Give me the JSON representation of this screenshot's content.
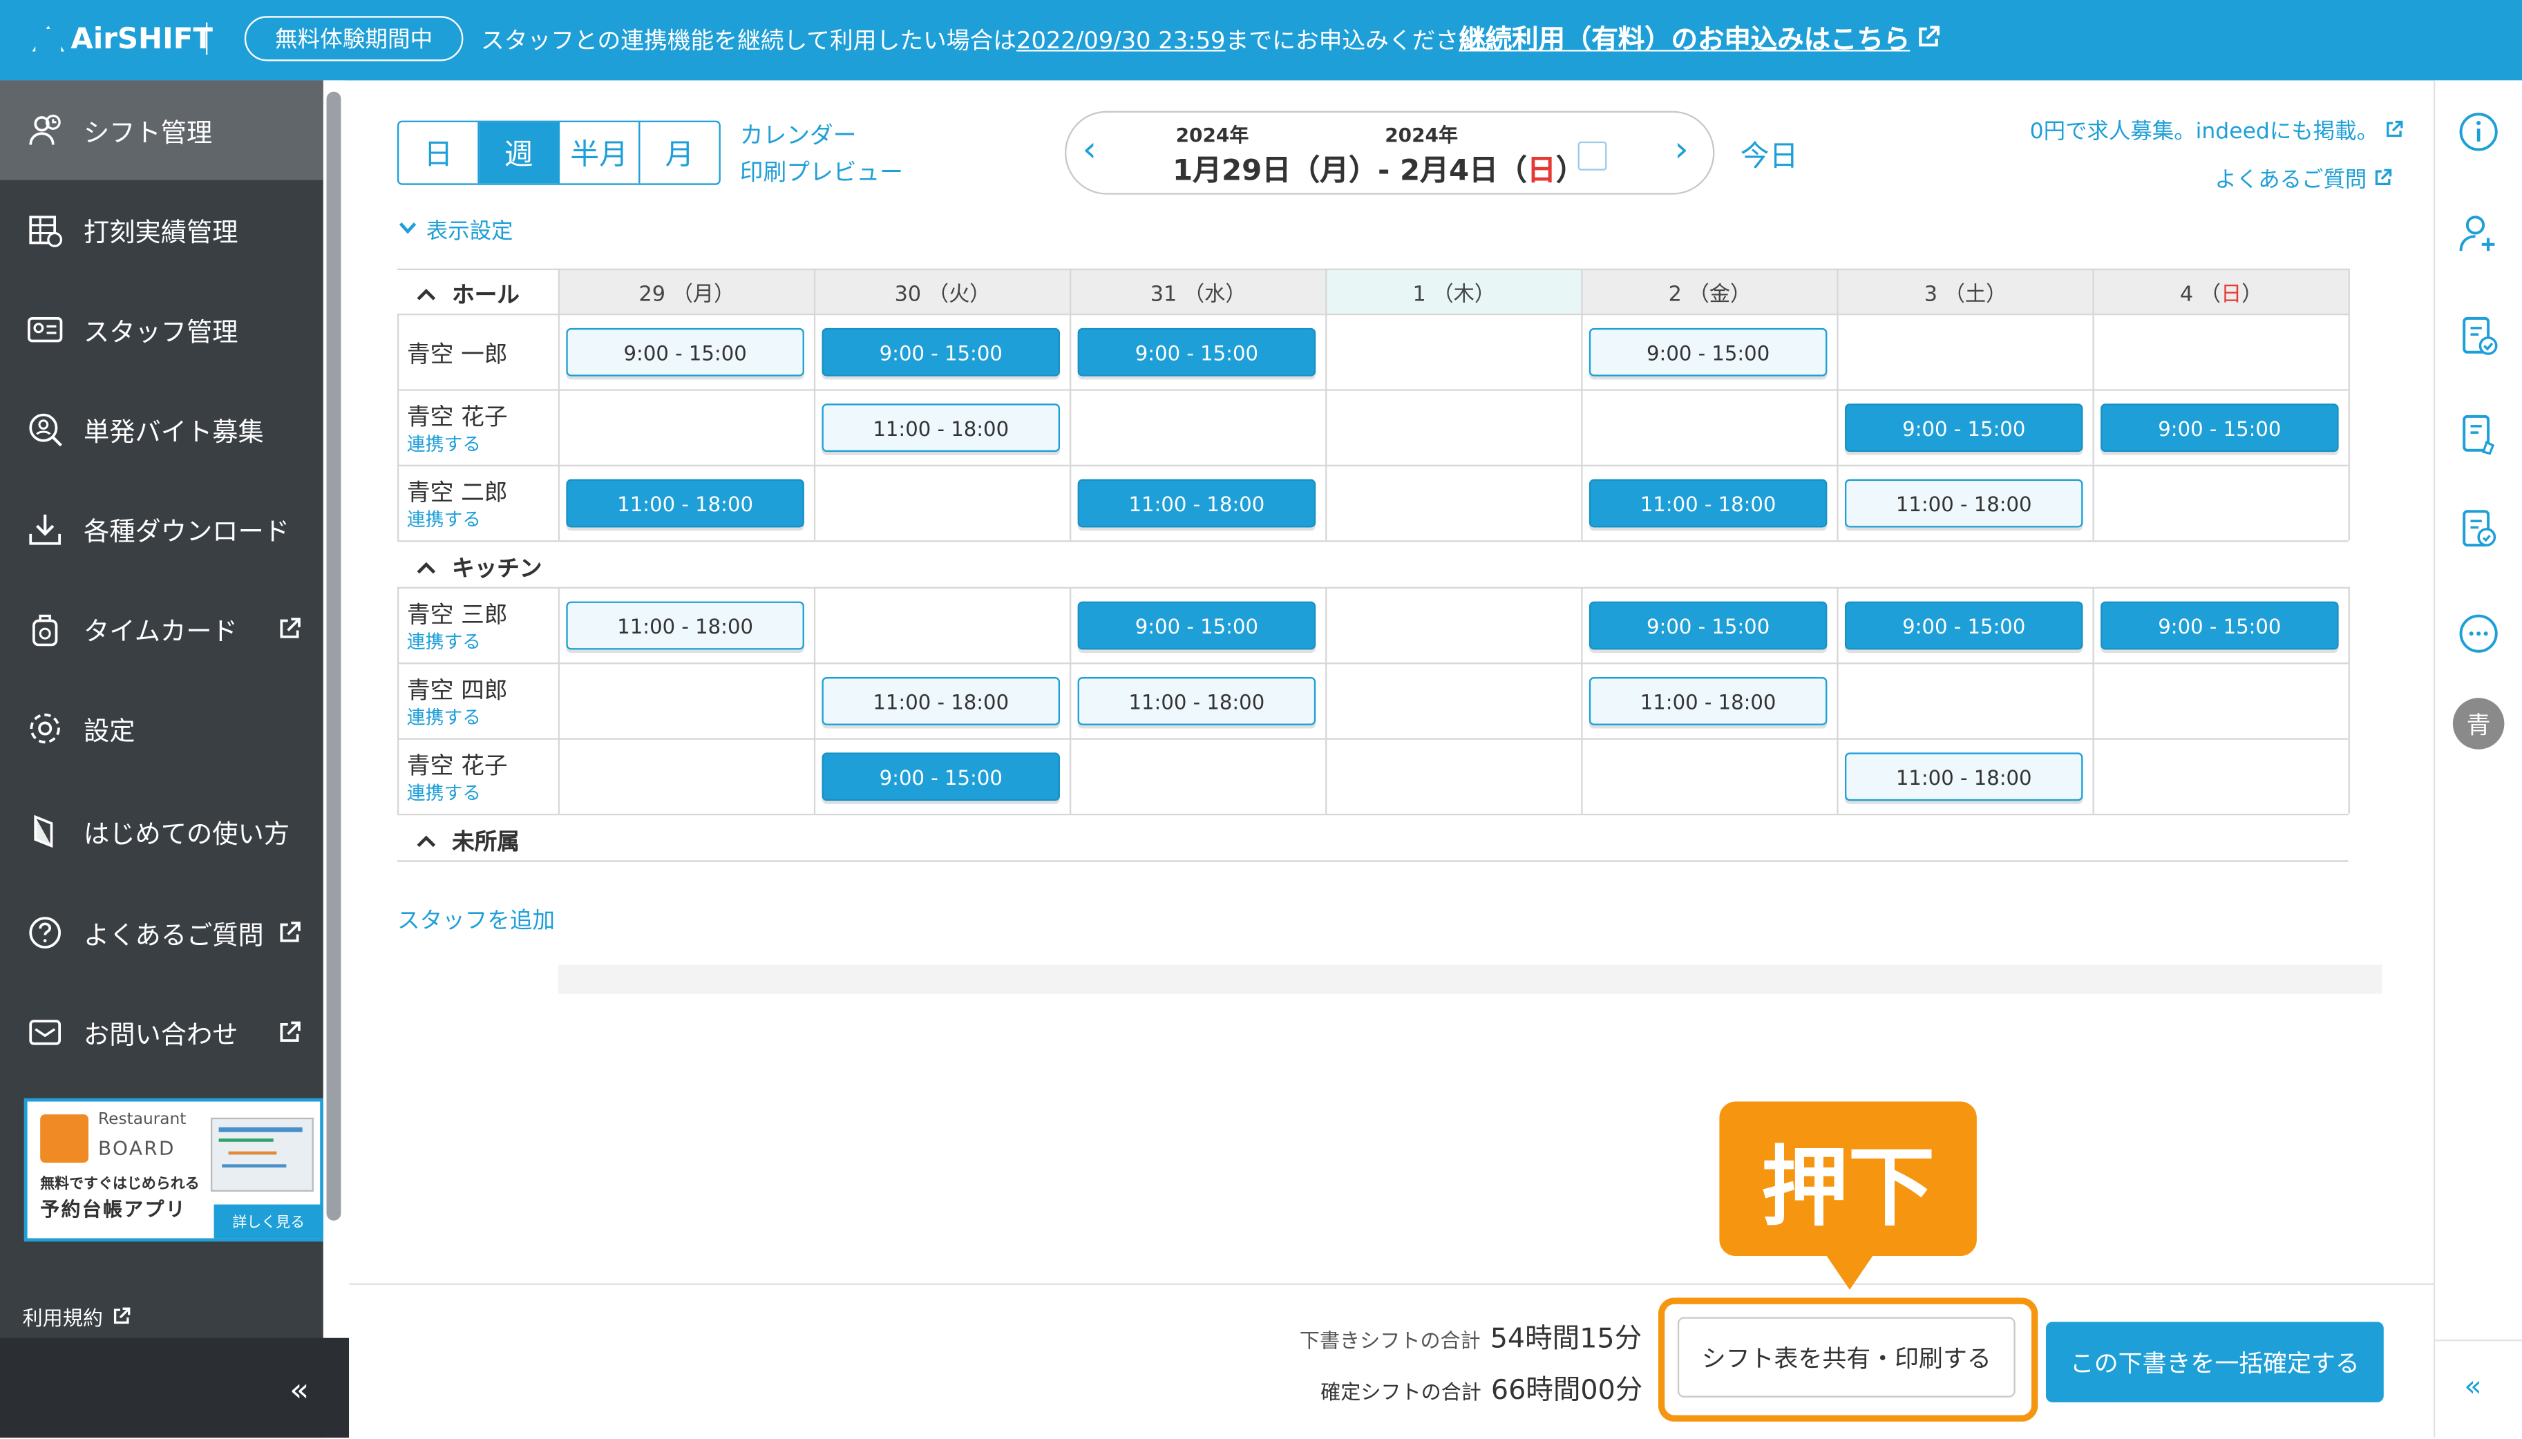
{
  "banner": {
    "logo": "AirSHIFT",
    "trial_badge": "無料体験期間中",
    "message_prefix": "スタッフとの連携機能を継続して利用したい場合は",
    "deadline": "2022/09/30 23:59",
    "message_suffix": "までにお申込みください。",
    "cta_link": "継続利用（有料）のお申込みはこちら"
  },
  "sidebar": {
    "items": [
      {
        "label": "シフト管理",
        "icon": "shift-icon"
      },
      {
        "label": "打刻実績管理",
        "icon": "timesheet-icon"
      },
      {
        "label": "スタッフ管理",
        "icon": "staff-card-icon"
      },
      {
        "label": "単発バイト募集",
        "icon": "person-search-icon"
      },
      {
        "label": "各種ダウンロード",
        "icon": "download-icon"
      },
      {
        "label": "タイムカード",
        "icon": "timecard-icon"
      },
      {
        "label": "設定",
        "icon": "gear-icon"
      },
      {
        "label": "はじめての使い方",
        "icon": "guide-icon"
      },
      {
        "label": "よくあるご質問",
        "icon": "question-icon"
      },
      {
        "label": "お問い合わせ",
        "icon": "mail-icon"
      }
    ],
    "ad": {
      "brand_top": "Restaurant",
      "brand_bottom": "BOARD",
      "line1": "無料ですぐはじめられる",
      "line2": "予約台帳アプリ",
      "more": "詳しく見る"
    },
    "terms": "利用規約",
    "collapse": "«"
  },
  "toolbar": {
    "views": [
      "日",
      "週",
      "半月",
      "月"
    ],
    "selected_view": "週",
    "calendar_link": "カレンダー",
    "print_preview_link": "印刷プレビュー",
    "year_start": "2024年",
    "year_end": "2024年",
    "range_start": "1月29日（月）",
    "range_sep": "- ",
    "range_end_prefix": "2月4日（",
    "range_end_day": "日",
    "range_end_suffix": "）",
    "today": "今日",
    "indeed_link": "0円で求人募集。indeedにも掲載。",
    "faq_link": "よくあるご質問",
    "display_settings": "表示設定"
  },
  "grid": {
    "days": [
      {
        "num": "29",
        "dow": "月"
      },
      {
        "num": "30",
        "dow": "火"
      },
      {
        "num": "31",
        "dow": "水"
      },
      {
        "num": "1",
        "dow": "木"
      },
      {
        "num": "2",
        "dow": "金"
      },
      {
        "num": "3",
        "dow": "土"
      },
      {
        "num": "4",
        "dow": "日"
      }
    ],
    "groups": {
      "hall": "ホール",
      "kitchen": "キッチン",
      "unassigned": "未所属"
    },
    "link_label": "連携する",
    "staff": [
      {
        "name": "青空 一郎",
        "linkable": false,
        "shifts": [
          {
            "day": 0,
            "time": "9:00 - 15:00",
            "style": "light"
          },
          {
            "day": 1,
            "time": "9:00 - 15:00",
            "style": "solid"
          },
          {
            "day": 2,
            "time": "9:00 - 15:00",
            "style": "solid"
          },
          {
            "day": 4,
            "time": "9:00 - 15:00",
            "style": "light"
          }
        ]
      },
      {
        "name": "青空 花子",
        "linkable": true,
        "shifts": [
          {
            "day": 1,
            "time": "11:00 - 18:00",
            "style": "light"
          },
          {
            "day": 5,
            "time": "9:00 - 15:00",
            "style": "solid"
          },
          {
            "day": 6,
            "time": "9:00 - 15:00",
            "style": "solid"
          }
        ]
      },
      {
        "name": "青空 二郎",
        "linkable": true,
        "shifts": [
          {
            "day": 0,
            "time": "11:00 - 18:00",
            "style": "solid"
          },
          {
            "day": 2,
            "time": "11:00 - 18:00",
            "style": "solid"
          },
          {
            "day": 4,
            "time": "11:00 - 18:00",
            "style": "solid"
          },
          {
            "day": 5,
            "time": "11:00 - 18:00",
            "style": "light"
          }
        ]
      },
      {
        "name": "青空 三郎",
        "linkable": true,
        "shifts": [
          {
            "day": 0,
            "time": "11:00 - 18:00",
            "style": "light"
          },
          {
            "day": 2,
            "time": "9:00 - 15:00",
            "style": "solid"
          },
          {
            "day": 4,
            "time": "9:00 - 15:00",
            "style": "solid"
          },
          {
            "day": 5,
            "time": "9:00 - 15:00",
            "style": "solid"
          },
          {
            "day": 6,
            "time": "9:00 - 15:00",
            "style": "solid"
          }
        ]
      },
      {
        "name": "青空 四郎",
        "linkable": true,
        "shifts": [
          {
            "day": 1,
            "time": "11:00 - 18:00",
            "style": "light"
          },
          {
            "day": 2,
            "time": "11:00 - 18:00",
            "style": "light"
          },
          {
            "day": 4,
            "time": "11:00 - 18:00",
            "style": "light"
          }
        ]
      },
      {
        "name": "青空 花子",
        "linkable": true,
        "shifts": [
          {
            "day": 1,
            "time": "9:00 - 15:00",
            "style": "solid"
          },
          {
            "day": 5,
            "time": "11:00 - 18:00",
            "style": "light"
          }
        ]
      }
    ],
    "add_staff": "スタッフを追加"
  },
  "footer": {
    "draft_label": "下書きシフトの合計",
    "draft_total": "54時間15分",
    "confirmed_label": "確定シフトの合計",
    "confirmed_total": "66時間00分",
    "share_button": "シフト表を共有・印刷する",
    "confirm_button": "この下書きを一括確定する"
  },
  "annotation": {
    "callout_text": "押下",
    "color": "#f6950f"
  },
  "right_rail": {
    "avatar_initial": "青",
    "icons": [
      "info-icon",
      "add-user-icon",
      "document-check-icon",
      "document-edit-icon",
      "document-search-icon",
      "chat-icon"
    ],
    "collapse": "«"
  },
  "colors": {
    "accent": "#1e9fd8",
    "sidebar_bg": "#3a3f44",
    "sunday_red": "#e53935",
    "highlight_orange": "#f6950f"
  }
}
